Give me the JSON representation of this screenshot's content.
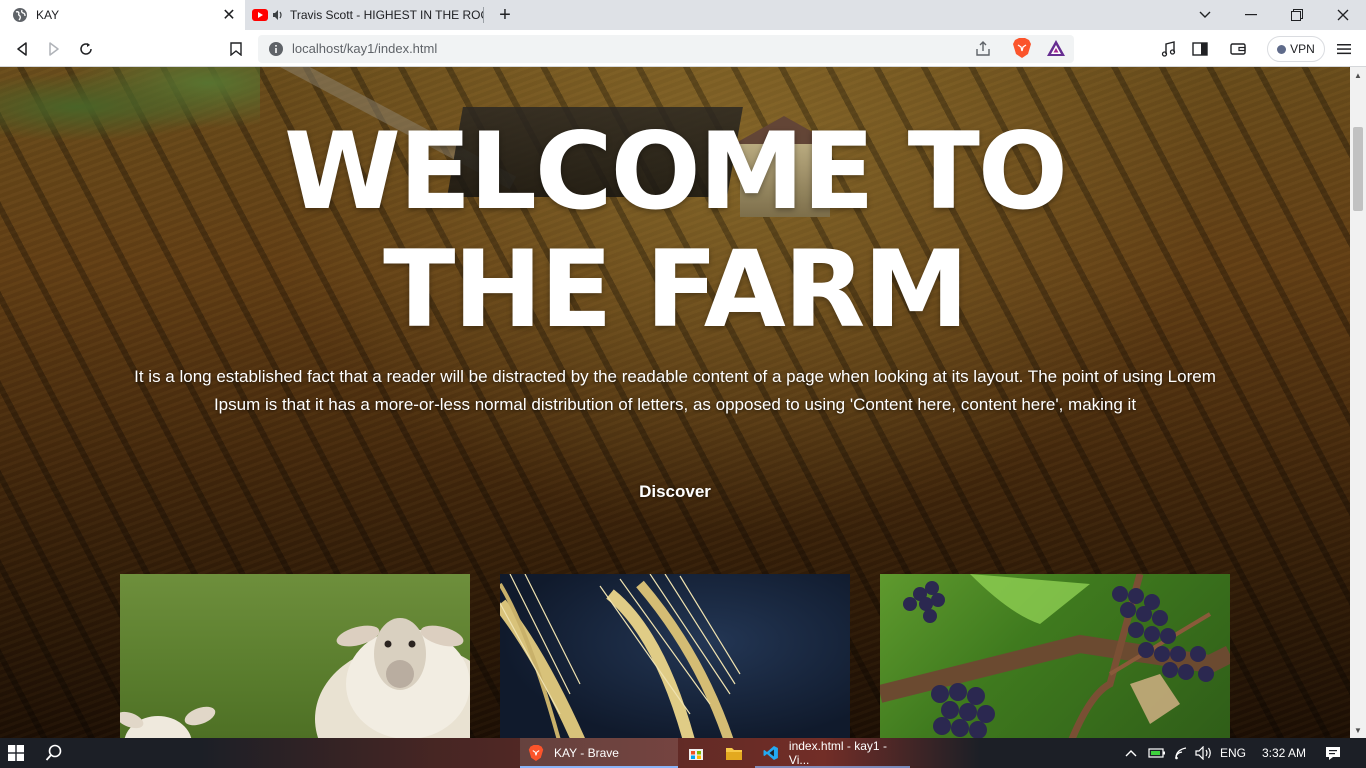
{
  "browser": {
    "tabs": [
      {
        "title": "KAY",
        "active": true
      },
      {
        "title": "Travis Scott - HIGHEST IN THE ROOM",
        "active": false,
        "audio": true
      }
    ],
    "url": "localhost/kay1/index.html",
    "vpn_label": "VPN"
  },
  "page": {
    "hero_title": "WELCOME TO THE FARM",
    "hero_text": "It is a long established fact that a reader will be distracted by the readable content of a page when looking at its layout. The point of using Lorem Ipsum is that it has a more-or-less normal distribution of letters, as opposed to using 'Content here, content here', making it",
    "discover_label": "Discover",
    "cards": [
      {
        "subject": "sheep"
      },
      {
        "subject": "wheat"
      },
      {
        "subject": "grapes"
      }
    ]
  },
  "taskbar": {
    "apps": [
      {
        "label": "KAY - Brave",
        "active": true
      },
      {
        "label": "index.html - kay1 - Vi...",
        "active": false
      }
    ],
    "language": "ENG",
    "time": "3:32 AM"
  },
  "colors": {
    "brave_orange": "#fb542b",
    "youtube_red": "#ff0000",
    "vscode_blue": "#23a9f2",
    "rewards_purple": "#662d91"
  }
}
